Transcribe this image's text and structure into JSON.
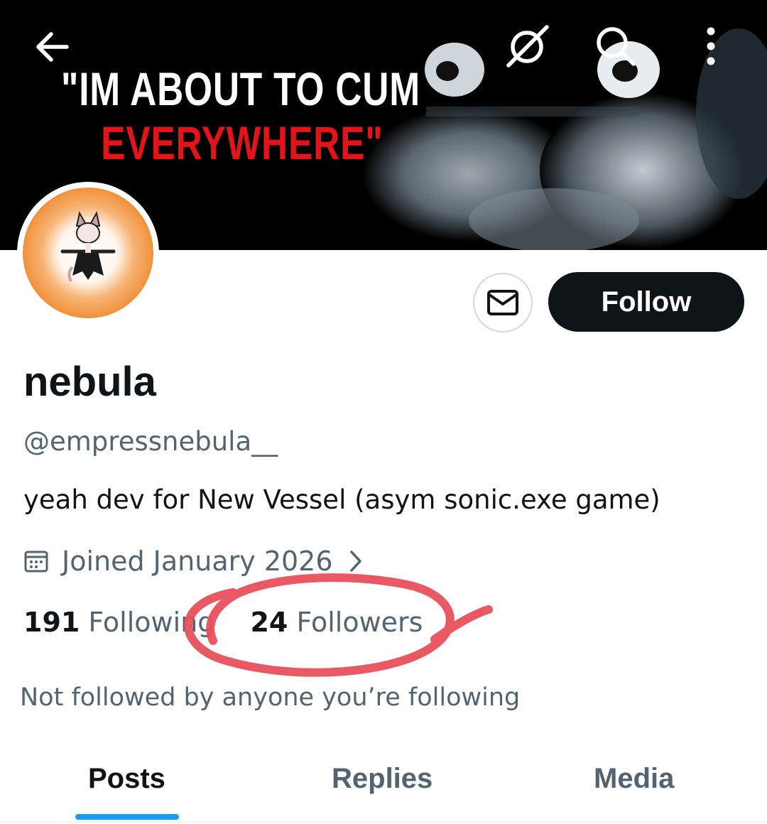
{
  "header": {
    "banner_text_line1": "\"IM ABOUT TO CUM",
    "banner_text_line2": "EVERYWHERE\"",
    "icons": [
      "back-arrow-icon",
      "grok-icon",
      "search-icon",
      "more-vertical-icon"
    ]
  },
  "profile": {
    "display_name": "nebula",
    "handle": "@empressnebula__",
    "bio": "yeah dev for New Vessel (asym sonic.exe game)",
    "joined": "Joined January 2026",
    "following_count": "191",
    "following_label": "Following",
    "followers_count": "24",
    "followers_label": "Followers",
    "not_followed_text": "Not followed by anyone you’re following"
  },
  "actions": {
    "follow_label": "Follow",
    "message_icon": "envelope-icon"
  },
  "tabs": [
    {
      "label": "Posts",
      "active": true
    },
    {
      "label": "Replies",
      "active": false
    },
    {
      "label": "Media",
      "active": false
    }
  ],
  "colors": {
    "accent": "#1d9bf0",
    "text_primary": "#0f1419",
    "text_secondary": "#536471",
    "annotation_red": "#e8505b",
    "avatar_ring": "#f0913a"
  }
}
